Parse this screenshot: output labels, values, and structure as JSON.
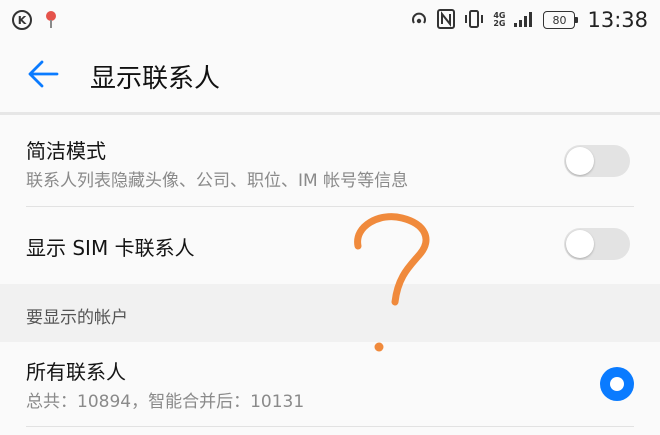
{
  "status_bar": {
    "k_badge": "K",
    "network_top": "4G",
    "network_bottom": "2G",
    "battery": "80",
    "time": "13:38"
  },
  "app_bar": {
    "back_icon": "arrow-left-icon",
    "title": "显示联系人"
  },
  "settings": {
    "simple_mode": {
      "title": "简洁模式",
      "subtitle": "联系人列表隐藏头像、公司、职位、IM 帐号等信息",
      "enabled": false
    },
    "show_sim": {
      "title": "显示 SIM 卡联系人",
      "enabled": false
    }
  },
  "accounts_section": {
    "header": "要显示的帐户",
    "all_contacts": {
      "title": "所有联系人",
      "subtitle": "总共：10894，智能合并后：10131",
      "selected": true
    }
  },
  "colors": {
    "accent": "#0a7bff",
    "scribble": "#f08a3c"
  }
}
